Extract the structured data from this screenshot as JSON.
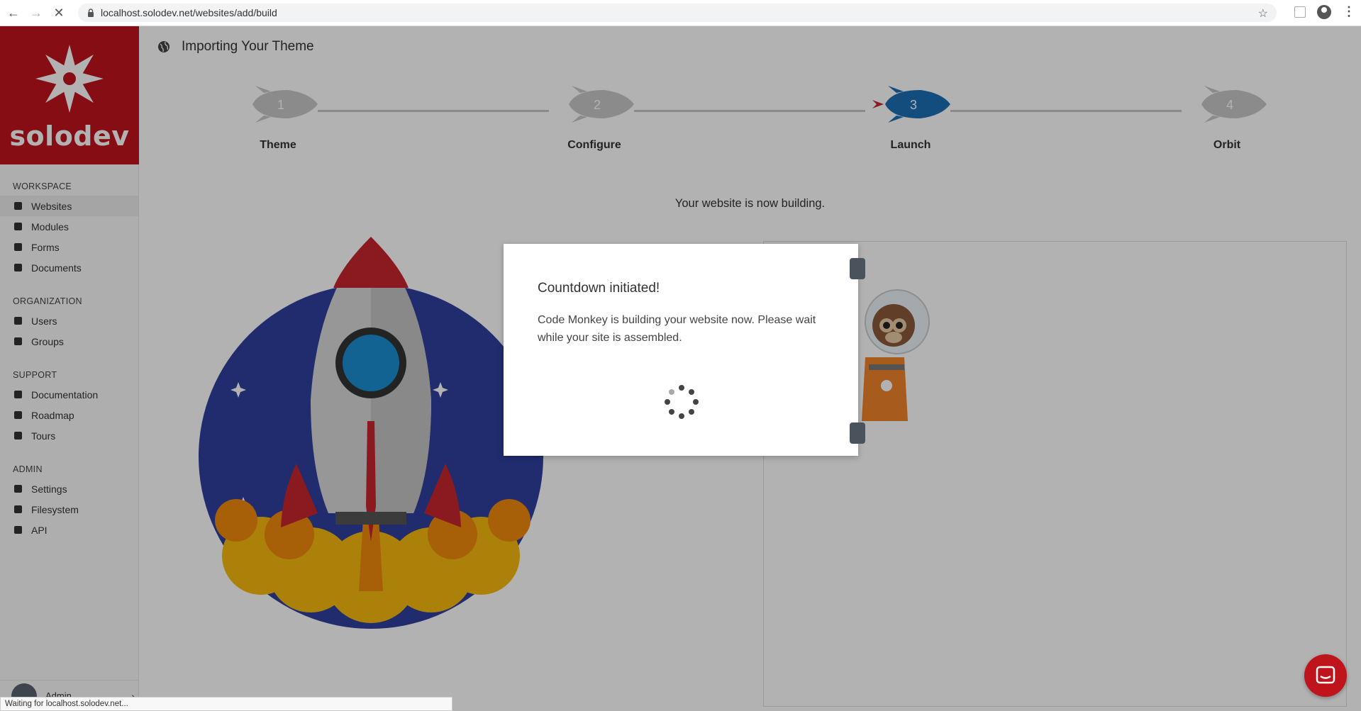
{
  "browser": {
    "url": "localhost.solodev.net/websites/add/build"
  },
  "brand": {
    "name": "solodev"
  },
  "sidebar": {
    "sections": [
      {
        "heading": "WORKSPACE",
        "items": [
          {
            "label": "Websites",
            "icon": "globe-icon"
          },
          {
            "label": "Modules",
            "icon": "cubes-icon"
          },
          {
            "label": "Forms",
            "icon": "form-icon"
          },
          {
            "label": "Documents",
            "icon": "document-icon"
          }
        ]
      },
      {
        "heading": "ORGANIZATION",
        "items": [
          {
            "label": "Users",
            "icon": "user-icon"
          },
          {
            "label": "Groups",
            "icon": "users-icon"
          }
        ]
      },
      {
        "heading": "SUPPORT",
        "items": [
          {
            "label": "Documentation",
            "icon": "file-icon"
          },
          {
            "label": "Roadmap",
            "icon": "signs-icon"
          },
          {
            "label": "Tours",
            "icon": "compass-icon"
          }
        ]
      },
      {
        "heading": "ADMIN",
        "items": [
          {
            "label": "Settings",
            "icon": "gear-icon"
          },
          {
            "label": "Filesystem",
            "icon": "list-icon"
          },
          {
            "label": "API",
            "icon": "sitemap-icon"
          }
        ]
      }
    ],
    "user": {
      "name": "Admin"
    }
  },
  "page": {
    "title": "Importing Your Theme",
    "status": "Your website is now building."
  },
  "steps": [
    {
      "number": "1",
      "label": "Theme",
      "active": false
    },
    {
      "number": "2",
      "label": "Configure",
      "active": false
    },
    {
      "number": "3",
      "label": "Launch",
      "active": true
    },
    {
      "number": "4",
      "label": "Orbit",
      "active": false
    }
  ],
  "modal": {
    "title": "Countdown initiated!",
    "body": "Code Monkey is building your website now. Please wait while your site is assembled."
  },
  "status_bar": {
    "text": "Waiting for localhost.solodev.net..."
  },
  "colors": {
    "brand": "#c0141c",
    "step_active": "#1a6fb5",
    "step_inactive": "#c7c7c7"
  }
}
